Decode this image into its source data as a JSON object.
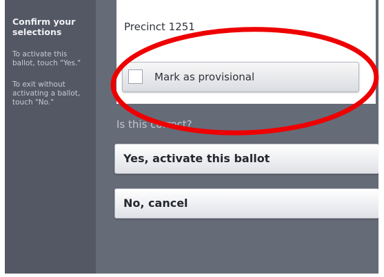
{
  "sidebar": {
    "title": "Confirm your selections",
    "activate_instruction": "To activate this ballot, touch \"Yes.\"",
    "exit_instruction": "To exit without activating a ballot, touch \"No.\""
  },
  "card": {
    "precinct": "Precinct 1251",
    "provisional_label": "Mark as provisional",
    "provisional_checked": false
  },
  "prompt": {
    "question": "Is this correct?"
  },
  "actions": {
    "yes_label": "Yes, activate this ballot",
    "no_label": "No, cancel"
  },
  "colors": {
    "annotation": "#ee0000",
    "sidebar_bg": "#545865",
    "screen_bg": "#666b78"
  }
}
